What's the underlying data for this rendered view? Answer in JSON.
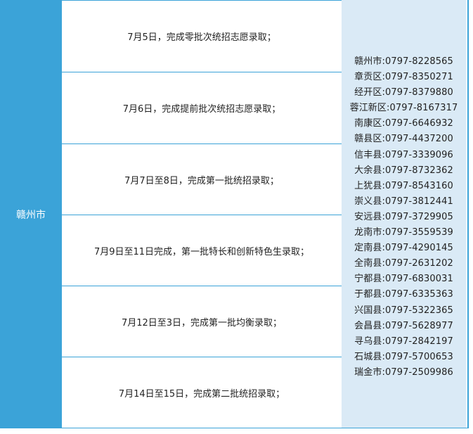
{
  "city": "赣州市",
  "schedule": [
    "7月5日，完成零批次统招志愿录取；",
    "7月6日，完成提前批次统招志愿录取；",
    "7月7日至8日，完成第一批统招录取；",
    "7月9日至11日完成，第一批特长和创新特色生录取；",
    "7月12日至3日，完成第一批均衡录取；",
    "7月14日至15日，完成第二批统招录取；"
  ],
  "phones": [
    "赣州市:0797-8228565",
    "章贡区:0797-8350271",
    "经开区:0797-8379880",
    "蓉江新区:0797-8167317",
    "南康区:0797-6646932",
    "赣县区:0797-4437200",
    "信丰县:0797-3339096",
    "大余县:0797-8732362",
    "上犹县:0797-8543160",
    "崇义县:0797-3812441",
    "安远县:0797-3729905",
    "龙南市:0797-3559539",
    "定南县:0797-4290145",
    "全南县:0797-2631202",
    "宁都县:0797-6830031",
    "于都县:0797-6335363",
    "兴国县:0797-5322365",
    "会昌县:0797-5628977",
    "寻乌县:0797-2842197",
    "石城县:0797-5700653",
    "瑞金市:0797-2509986"
  ],
  "colors": {
    "accent": "#3ba3d8",
    "phone_bg": "#daeaf6"
  }
}
